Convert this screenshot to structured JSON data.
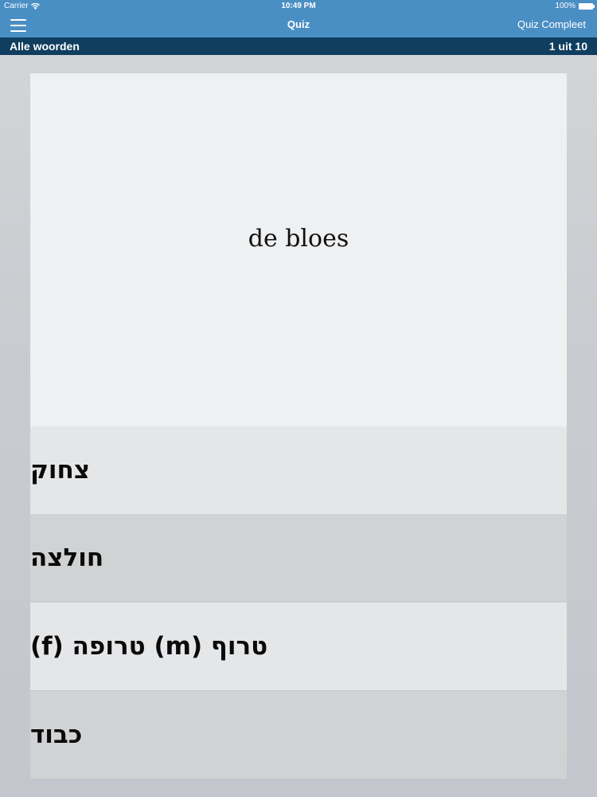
{
  "status_bar": {
    "carrier": "Carrier",
    "time": "10:49 PM",
    "battery": "100%",
    "wifi_icon": "wifi-icon",
    "battery_icon": "battery-icon"
  },
  "nav": {
    "menu_icon": "hamburger-menu-icon",
    "title": "Quiz",
    "complete_label": "Quiz Compleet"
  },
  "sub_header": {
    "category": "Alle woorden",
    "progress": "1 uit 10"
  },
  "question": {
    "word": "de bloes"
  },
  "answers": [
    {
      "label": "צחוק"
    },
    {
      "label": "חולצה"
    },
    {
      "label": "טרוף (m)  טרופה (f)"
    },
    {
      "label": "כבוד"
    }
  ],
  "colors": {
    "nav_bar": "#4a8fc4",
    "sub_header": "#0f3e5f",
    "question_bg": "#eff0f2",
    "answer_light": "#e5e6e8",
    "answer_dark": "#d1d2d4"
  }
}
